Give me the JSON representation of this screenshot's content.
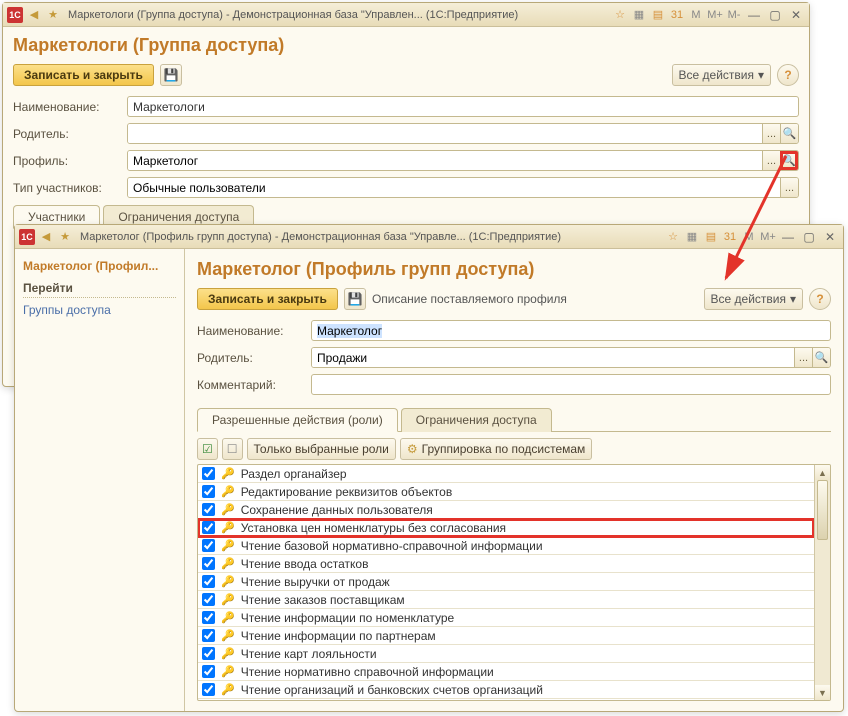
{
  "win1": {
    "title": "Маркетологи (Группа доступа) - Демонстрационная база \"Управлен...   (1С:Предприятие)",
    "page_title": "Маркетологи (Группа доступа)",
    "save_close": "Записать и закрыть",
    "all_actions": "Все действия",
    "labels": {
      "name": "Наименование:",
      "parent": "Родитель:",
      "profile": "Профиль:",
      "member_type": "Тип участников:"
    },
    "values": {
      "name": "Маркетологи",
      "parent": "",
      "profile": "Маркетолог",
      "member_type": "Обычные пользователи"
    },
    "tabs": {
      "members": "Участники",
      "restrictions": "Ограничения доступа"
    }
  },
  "win2": {
    "title": "Маркетолог (Профиль групп доступа) - Демонстрационная база \"Управле...   (1С:Предприятие)",
    "sidebar": {
      "title": "Маркетолог (Профил...",
      "goto": "Перейти",
      "link1": "Группы доступа"
    },
    "page_title": "Маркетолог (Профиль групп доступа)",
    "save_close": "Записать и закрыть",
    "profile_desc": "Описание поставляемого профиля",
    "all_actions": "Все действия",
    "labels": {
      "name": "Наименование:",
      "parent": "Родитель:",
      "comment": "Комментарий:"
    },
    "values": {
      "name": "Маркетолог",
      "parent": "Продажи",
      "comment": ""
    },
    "tabs": {
      "roles": "Разрешенные действия (роли)",
      "restrictions": "Ограничения доступа"
    },
    "toolbar": {
      "only_selected": "Только выбранные роли",
      "group_by_subsys": "Группировка по подсистемам"
    },
    "roles": [
      "Раздел органайзер",
      "Редактирование реквизитов объектов",
      "Сохранение данных пользователя",
      "Установка цен номенклатуры без согласования",
      "Чтение базовой нормативно-справочной информации",
      "Чтение ввода остатков",
      "Чтение выручки от продаж",
      "Чтение заказов поставщикам",
      "Чтение информации по номенклатуре",
      "Чтение информации по партнерам",
      "Чтение карт лояльности",
      "Чтение нормативно справочной информации",
      "Чтение организаций и банковских счетов организаций"
    ]
  }
}
